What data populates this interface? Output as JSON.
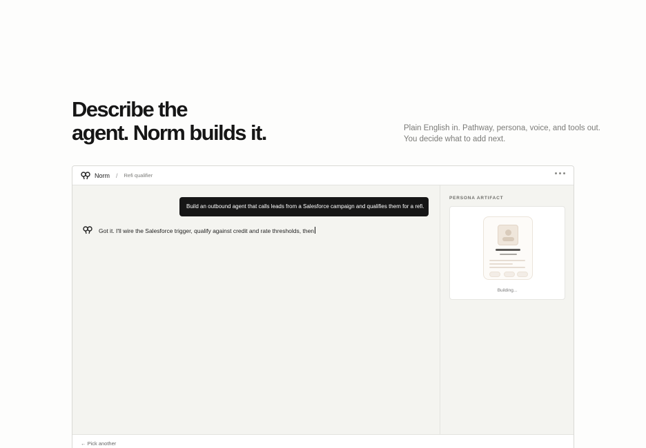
{
  "hero": {
    "headline_line1": "Describe the",
    "headline_line2": "agent. Norm builds it.",
    "sub_line1": "Plain English in. Pathway, persona, voice, and tools out.",
    "sub_line2": "You decide what to add next."
  },
  "window": {
    "app_name": "Norm",
    "separator": "/",
    "breadcrumb": "Refi qualifier",
    "menu_icon": "more-horizontal-icon"
  },
  "chat": {
    "user_message": "Build an outbound agent that calls leads from a Salesforce campaign and qualifies them for a refi.",
    "agent_message": "Got it. I'll wire the Salesforce trigger, qualify against credit and rate thresholds, then"
  },
  "side_panel": {
    "label": "PERSONA ARTIFACT",
    "status": "Building..."
  },
  "footer": {
    "back_label": "← Pick another"
  },
  "colors": {
    "background": "#fdfdfc",
    "panel": "#f4f4f0",
    "bubble": "#161616",
    "persona_accent": "#efe6db"
  }
}
